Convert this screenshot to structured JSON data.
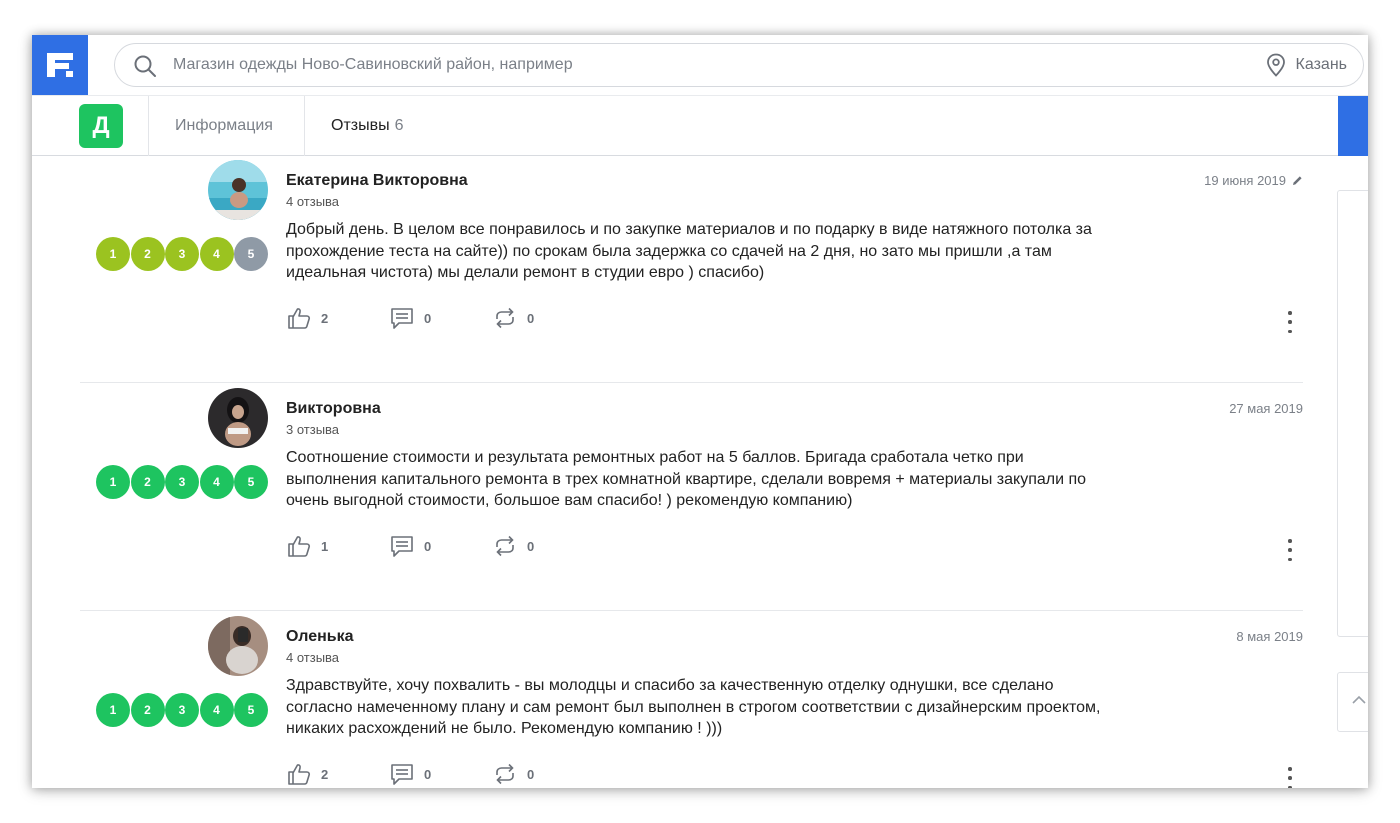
{
  "search": {
    "placeholder": "Магазин одежды Ново-Савиновский район, например",
    "city": "Казань"
  },
  "company": {
    "logo_letter": "Д"
  },
  "tabs": {
    "info_label": "Информация",
    "reviews_label": "Отзывы",
    "reviews_count": "6"
  },
  "colors": {
    "brand_blue": "#2f6fe4",
    "company_green": "#1ec460",
    "rating_green": "#1ec460",
    "rating_lime": "#9bc320",
    "rating_gray": "#8f9aa6"
  },
  "reviews": [
    {
      "author": "Екатерина Викторовна",
      "reviews_count": "4 отзыва",
      "date": "19 июня 2019",
      "edited": true,
      "rating": [
        "1",
        "2",
        "3",
        "4",
        "5"
      ],
      "rating_value": 4,
      "text": "Добрый день. В целом все понравилось и по закупке материалов и по подарку в виде натяжного потолка за прохождение теста на сайте)) по срокам была задержка со сдачей на 2 дня, но зато мы пришли ,а там идеальная чистота) мы делали ремонт в студии евро ) спасибо)",
      "likes": "2",
      "comments": "0",
      "reposts": "0"
    },
    {
      "author": "Викторовна",
      "reviews_count": "3 отзыва",
      "date": "27 мая 2019",
      "edited": false,
      "rating": [
        "1",
        "2",
        "3",
        "4",
        "5"
      ],
      "rating_value": 5,
      "text": "Соотношение стоимости и результата ремонтных работ на 5 баллов. Бригада сработала четко при выполнения капитального ремонта в трех комнатной квартире, сделали вовремя + материалы закупали по очень выгодной стоимости, большое вам спасибо! ) рекомендую компанию)",
      "likes": "1",
      "comments": "0",
      "reposts": "0"
    },
    {
      "author": "Оленька",
      "reviews_count": "4 отзыва",
      "date": "8 мая 2019",
      "edited": false,
      "rating": [
        "1",
        "2",
        "3",
        "4",
        "5"
      ],
      "rating_value": 5,
      "text": "Здравствуйте, хочу похвалить - вы молодцы и спасибо за качественную отделку однушки, все сделано согласно намеченному плану и сам ремонт был выполнен в строгом соответствии с дизайнерским проектом, никаких расхождений не было. Рекомендую компанию ! )))",
      "likes": "2",
      "comments": "0",
      "reposts": "0"
    }
  ]
}
